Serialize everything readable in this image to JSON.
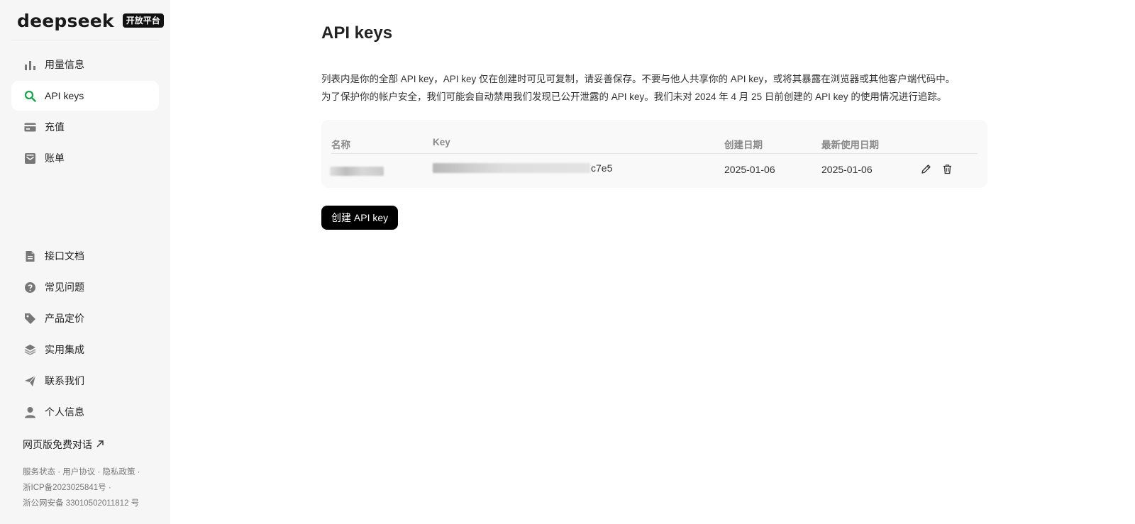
{
  "sidebar": {
    "brand": {
      "logo": "deepseek",
      "badge": "开放平台"
    },
    "top_items": [
      {
        "label": "用量信息",
        "icon": "bar-chart-icon"
      },
      {
        "label": "API keys",
        "icon": "search-icon",
        "active": true
      },
      {
        "label": "充值",
        "icon": "card-icon"
      },
      {
        "label": "账单",
        "icon": "bill-icon"
      }
    ],
    "bottom_items": [
      {
        "label": "接口文档",
        "icon": "document-icon"
      },
      {
        "label": "常见问题",
        "icon": "question-icon"
      },
      {
        "label": "产品定价",
        "icon": "tag-icon"
      },
      {
        "label": "实用集成",
        "icon": "layers-icon"
      },
      {
        "label": "联系我们",
        "icon": "send-icon"
      },
      {
        "label": "个人信息",
        "icon": "user-icon"
      }
    ],
    "free_chat": "网页版免费对话",
    "footer": {
      "status": "服务状态",
      "terms": "用户协议",
      "privacy": "隐私政策",
      "icp": "浙ICP备2023025841号",
      "police": "浙公网安备 33010502011812 号"
    }
  },
  "main": {
    "title": "API keys",
    "description": [
      "列表内是你的全部 API key，API key 仅在创建时可见可复制，请妥善保存。不要与他人共享你的 API key，或将其暴露在浏览器或其他客户端代码中。",
      "为了保护你的帐户安全，我们可能会自动禁用我们发现已公开泄露的 API key。我们未对 2024 年 4 月 25 日前创建的 API key 的使用情况进行追踪。"
    ],
    "table": {
      "headers": {
        "name": "名称",
        "key": "Key",
        "created": "创建日期",
        "last_used": "最新使用日期"
      },
      "rows": [
        {
          "key_suffix": "c7e5",
          "created": "2025-01-06",
          "last_used": "2025-01-06"
        }
      ]
    },
    "create_button": "创建 API key"
  },
  "colors": {
    "accent": "#16a34a",
    "sidebar_bg": "#f6f6f7",
    "button_bg": "#000000"
  }
}
